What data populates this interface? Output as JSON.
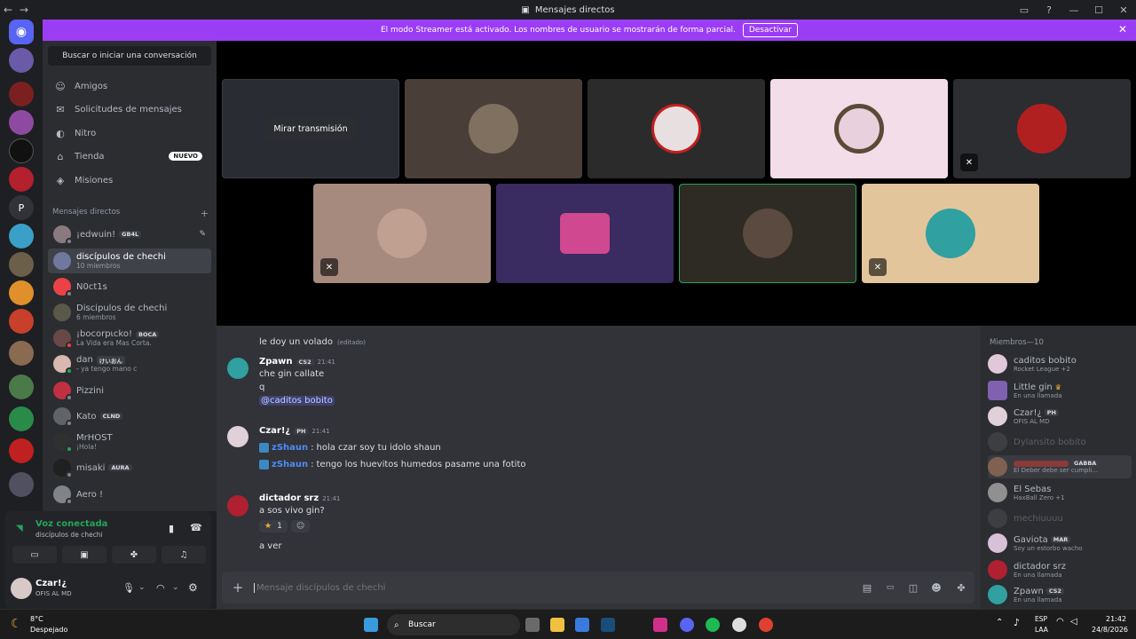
{
  "window": {
    "title": "Mensajes directos"
  },
  "banner": {
    "text": "El modo Streamer está activado. Los nombres de usuario se mostrarán de forma parcial.",
    "button": "Desactivar"
  },
  "sidebar": {
    "search": "Buscar o iniciar una conversación",
    "nav": [
      {
        "label": "Amigos",
        "icon": "friends-icon"
      },
      {
        "label": "Solicitudes de mensajes",
        "icon": "envelope-icon"
      },
      {
        "label": "Nitro",
        "icon": "nitro-icon"
      },
      {
        "label": "Tienda",
        "icon": "shop-icon",
        "badge": "NUEVO"
      },
      {
        "label": "Misiones",
        "icon": "quests-icon"
      }
    ],
    "dm_header": "Mensajes directos",
    "dms": [
      {
        "name": "¡edwuin!",
        "tag": "GB4L",
        "sub": ""
      },
      {
        "name": "discípulos de chechi",
        "sub": "10 miembros"
      },
      {
        "name": "N0ct1s",
        "sub": ""
      },
      {
        "name": "Discipulos de chechi",
        "sub": "6 miembros"
      },
      {
        "name": "¡bocorpιcko!",
        "tag": "BOCA",
        "sub": "La Vida era Mas Corta."
      },
      {
        "name": "dan",
        "tag": "けいおん",
        "sub": "- ya tengo mano c"
      },
      {
        "name": "Pizzini",
        "sub": ""
      },
      {
        "name": "Kato",
        "tag": "CLND",
        "sub": ""
      },
      {
        "name": "MrHOST",
        "sub": "¡Hola!"
      },
      {
        "name": "misaki",
        "tag": "AURA",
        "sub": ""
      },
      {
        "name": "Aero !",
        "sub": ""
      }
    ]
  },
  "voice": {
    "status": "Voz conectada",
    "channel": "discípulos de chechi",
    "user": "Czar!¿",
    "user_status": "OFIS AL MD"
  },
  "stage": {
    "watch_label": "Mirar transmisión",
    "tile_colors": [
      "#4a3f38",
      "#2b2b2b",
      "#f2dde8",
      "#2b2d31",
      "#a68a7e",
      "#3a2b61",
      "#2e2b25",
      "#e3c59b"
    ]
  },
  "chat": {
    "messages": [
      {
        "text": "le doy un volado",
        "edited": "(editado)"
      },
      {
        "author": "Zpawn",
        "tag": "CS2",
        "time": "21:41",
        "lines": [
          "che gin callate",
          "q"
        ],
        "mention": "@caditos bobito"
      },
      {
        "author": "Czar!¿",
        "tag": "PH",
        "time": "21:41",
        "bots": [
          {
            "name": "zShaun",
            "text": "hola czar soy tu idolo shaun"
          },
          {
            "name": "zShaun",
            "text": "tengo los huevitos humedos pasame una fotito"
          }
        ]
      },
      {
        "author": "dictador srz",
        "time": "21:41",
        "lines": [
          "a sos vivo gin?"
        ],
        "reaction_count": "1",
        "after": "a ver"
      }
    ],
    "input_placeholder": "Mensaje discípulos de chechi"
  },
  "members": {
    "header": "Miembros—10",
    "list": [
      {
        "name": "caditos bobito",
        "sub": "Rocket League +2"
      },
      {
        "name": "Little gin",
        "sub": "En una llamada"
      },
      {
        "name": "Czar!¿",
        "tag": "PH",
        "sub": "OFIS AL MD"
      },
      {
        "name": "Dylansito bobito",
        "sub": ""
      },
      {
        "name": "",
        "tag": "GABBA",
        "sub": "El Deber debe ser cumpli..."
      },
      {
        "name": "El Sebas",
        "sub": "HaxBall Zero +1"
      },
      {
        "name": "mechiuuuu",
        "sub": ""
      },
      {
        "name": "Gaviota",
        "tag": "MAR",
        "sub": "Soy un estorbo wacho"
      },
      {
        "name": "dictador srz",
        "sub": "En una llamada"
      },
      {
        "name": "Zpawn",
        "tag": "CS2",
        "sub": "En una llamada"
      }
    ]
  },
  "taskbar": {
    "weather_temp": "8°C",
    "weather_desc": "Despejado",
    "search": "Buscar",
    "lang": "ESP",
    "region": "LAA",
    "time": "21:42",
    "date": "24/8/2026"
  }
}
